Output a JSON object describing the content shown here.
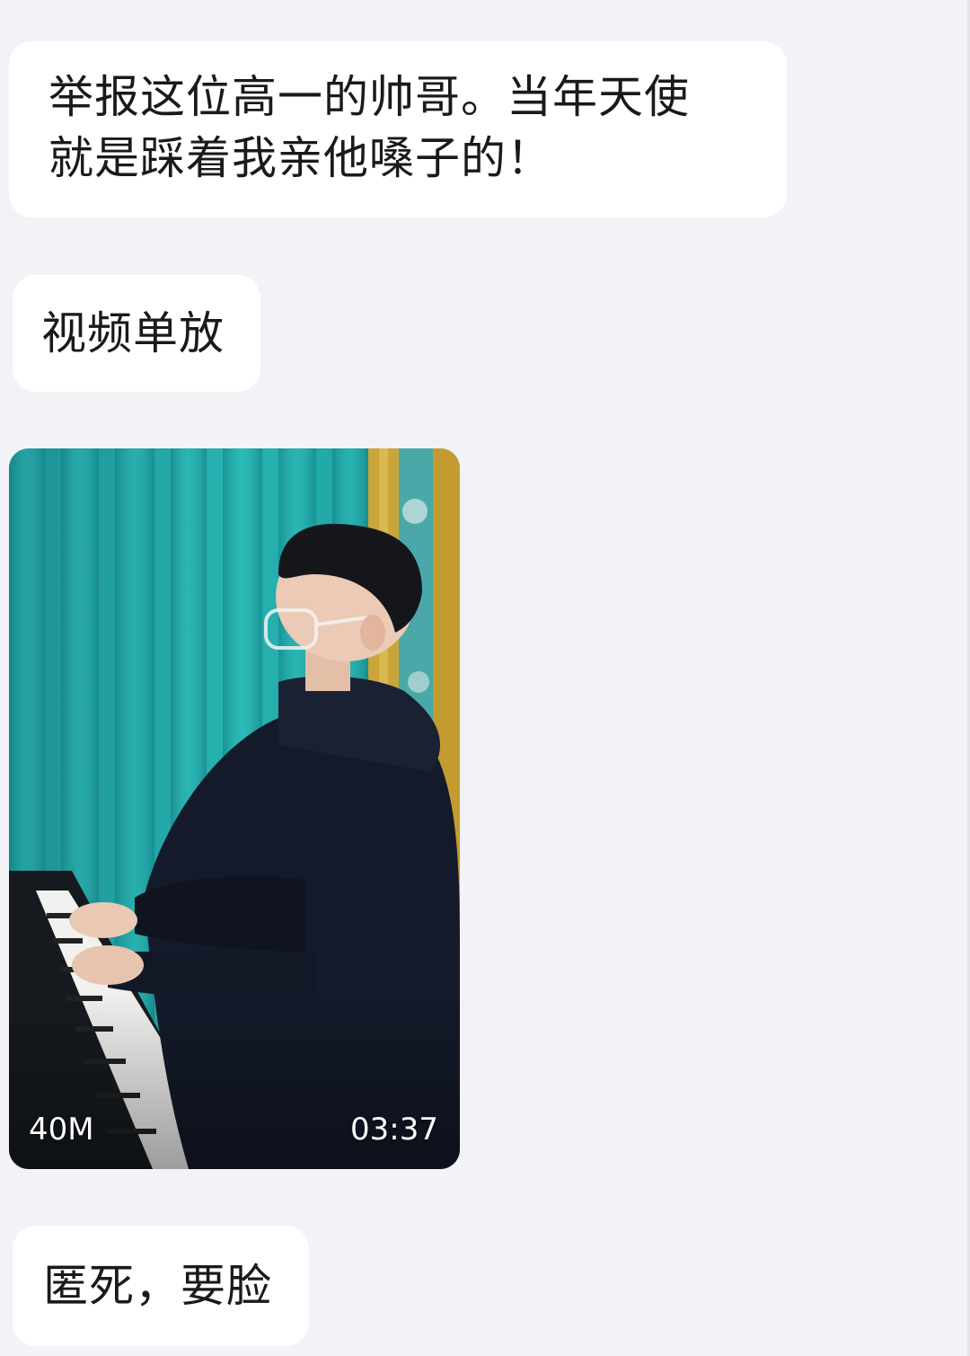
{
  "messages": [
    {
      "type": "text",
      "lines": [
        "举报这位高一的帅哥。当年天使",
        "就是踩着我亲他嗓子的！"
      ]
    },
    {
      "type": "text",
      "text": "视频单放"
    },
    {
      "type": "video",
      "file_size": "40M",
      "duration": "03:37",
      "thumbnail_icon": "video-thumbnail-boy-playing-piano"
    },
    {
      "type": "text",
      "text": "匿死，要脸"
    }
  ],
  "colors": {
    "background": "#f3f2f7",
    "bubble": "#ffffff",
    "text": "#1a1a1a",
    "curtain": "#1fa3a3",
    "hoodie": "#141a2a"
  }
}
